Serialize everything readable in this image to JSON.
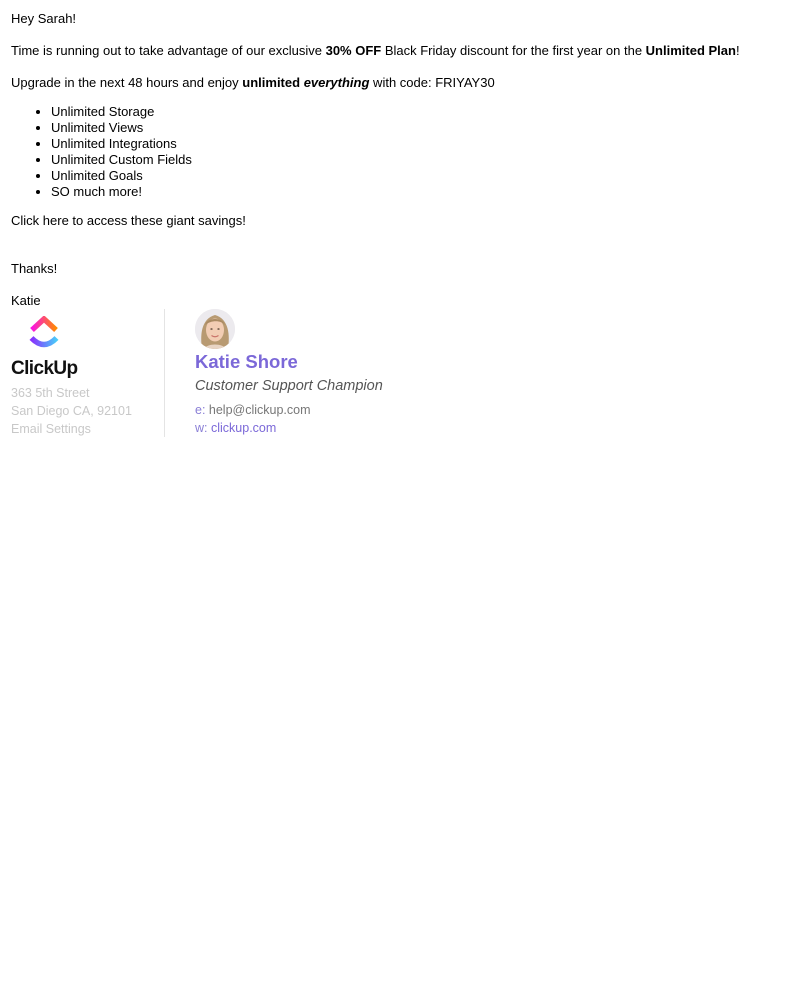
{
  "email": {
    "greeting": "Hey Sarah!",
    "para1": {
      "before": "Time is running out to take advantage of our exclusive ",
      "bold1": "30% OFF",
      "middle": " Black Friday discount for the first year on the ",
      "bold2": "Unlimited Plan",
      "after": "!"
    },
    "para2": {
      "before": "Upgrade in the next 48 hours and enjoy ",
      "bold": "unlimited",
      "space": " ",
      "bold_italic": "everything",
      "after": " with code: FRIYAY30"
    },
    "features": [
      "Unlimited Storage",
      "Unlimited Views",
      "Unlimited Integrations",
      "Unlimited Custom Fields",
      "Unlimited Goals",
      "SO much more!"
    ],
    "cta_link": "Click here to access these giant savings!",
    "thanks": "Thanks!",
    "signoff": "Katie"
  },
  "signature": {
    "company": {
      "logo_icon": "clickup-logo-icon",
      "wordmark": "ClickUp",
      "address_line1": "363 5th Street",
      "address_line2": "San Diego CA, 92101",
      "settings_link": "Email Settings"
    },
    "person": {
      "avatar_icon": "avatar-photo",
      "name": "Katie Shore",
      "title": "Customer Support Champion",
      "email_label": "e: ",
      "email": "help@clickup.com",
      "web_label": "w: ",
      "web": "clickup.com"
    }
  },
  "colors": {
    "accent_purple": "#7b68d8",
    "address_gray": "#c8c8c8",
    "logo_gradient_top": [
      "#fa12e3",
      "#ff8a00"
    ],
    "logo_gradient_bottom": [
      "#8930fd",
      "#49ccf9"
    ]
  }
}
